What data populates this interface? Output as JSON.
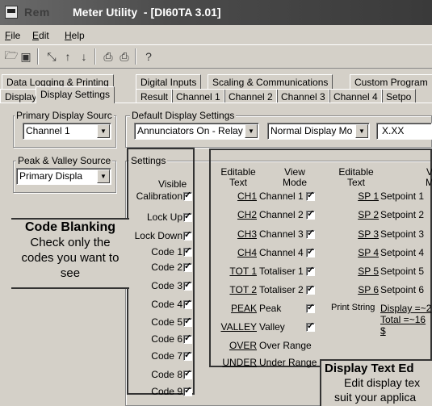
{
  "window": {
    "title_app": "Meter Utility",
    "title_doc": "- [DI60TA 3.01]"
  },
  "menu": [
    "File",
    "Edit",
    "Help"
  ],
  "tabs_row1": [
    "Data Logging & Printing",
    "Digital Inputs",
    "Scaling & Communications",
    "Custom Program"
  ],
  "tabs_row2": [
    "Display",
    "Display Settings",
    "Result",
    "Channel 1",
    "Channel 2",
    "Channel 3",
    "Channel 4",
    "Setpo"
  ],
  "primary_display": {
    "label": "Primary Display Sourc",
    "value": "Channel 1"
  },
  "default_settings": {
    "label": "Default Display Settings",
    "annunciators": "Annunciators On - Relay",
    "display_mode": "Normal Display Mo",
    "format": "X.XX"
  },
  "peak_valley": {
    "label": "Peak & Valley Source",
    "value": "Primary Displa"
  },
  "settings": {
    "label": "Settings",
    "visible_header": "Visible",
    "rows": [
      "Calibration",
      "Lock Up",
      "Lock Down",
      "Code 1",
      "Code 2",
      "Code 3",
      "Code 4",
      "Code 5",
      "Code 6",
      "Code 7",
      "Code 8",
      "Code 9"
    ]
  },
  "display_text": {
    "hdr_editable": "Editable",
    "hdr_text": "Text",
    "hdr_view": "View",
    "hdr_mode": "Mode",
    "left_items": [
      {
        "text": "CH1",
        "mode": "Channel 1"
      },
      {
        "text": "CH2",
        "mode": "Channel 2"
      },
      {
        "text": "CH3",
        "mode": "Channel 3"
      },
      {
        "text": "CH4",
        "mode": "Channel 4"
      },
      {
        "text": "TOT 1",
        "mode": "Totaliser 1"
      },
      {
        "text": "TOT 2",
        "mode": "Totaliser 2"
      },
      {
        "text": "PEAK",
        "mode": "Peak"
      },
      {
        "text": "VALLEY",
        "mode": "Valley"
      },
      {
        "text": "OVER",
        "mode": "Over Range"
      },
      {
        "text": "UNDER",
        "mode": "Under Range"
      }
    ],
    "right_hdr_editable": "Editable",
    "right_hdr_text": "Text",
    "right_hdr_v": "V",
    "right_hdr_m": "M",
    "right_items": [
      {
        "text": "SP 1",
        "mode": "Setpoint 1"
      },
      {
        "text": "SP 2",
        "mode": "Setpoint 2"
      },
      {
        "text": "SP 3",
        "mode": "Setpoint 3"
      },
      {
        "text": "SP 4",
        "mode": "Setpoint 4"
      },
      {
        "text": "SP 5",
        "mode": "Setpoint 5"
      },
      {
        "text": "SP 6",
        "mode": "Setpoint 6"
      }
    ],
    "print_string_label": "Print String",
    "print_string_lines": [
      "Display =~2",
      "Total =~16",
      "$"
    ]
  },
  "annotation_code": {
    "title": "Code Blanking",
    "body": "Check only the codes you want to see"
  },
  "annotation_display": {
    "title": "Display Text Ed",
    "line1": "Edit display tex",
    "line2": "suit your applica"
  }
}
